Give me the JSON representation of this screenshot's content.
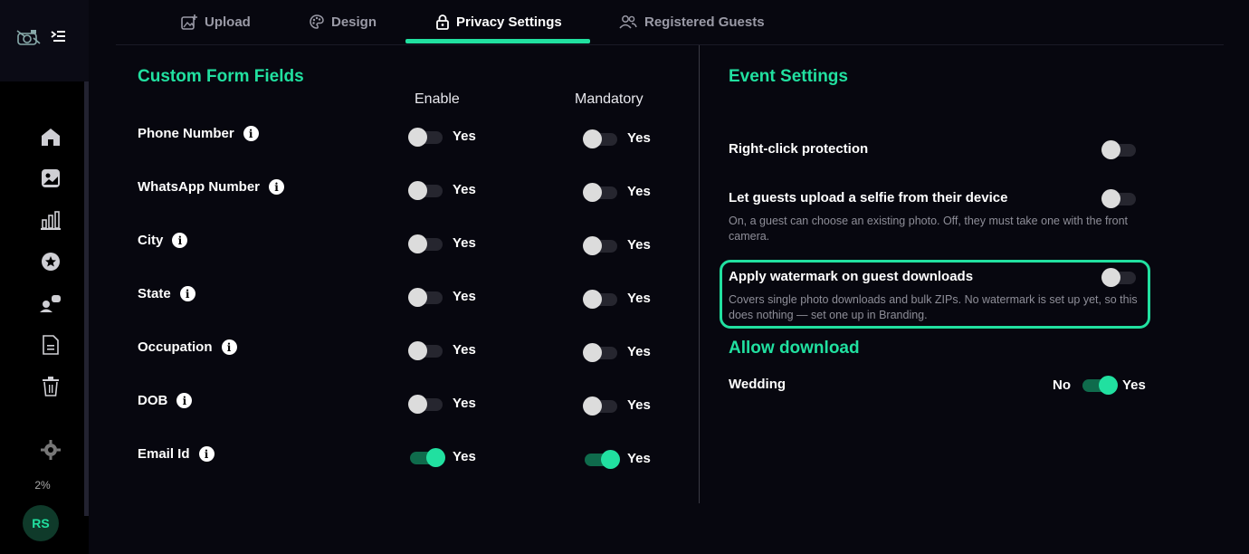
{
  "sidebar": {
    "usage_percent": "2%",
    "avatar_initials": "RS"
  },
  "tabs": [
    {
      "label": "Upload",
      "icon": "upload-image-icon"
    },
    {
      "label": "Design",
      "icon": "palette-icon"
    },
    {
      "label": "Privacy Settings",
      "icon": "lock-icon",
      "active": true
    },
    {
      "label": "Registered Guests",
      "icon": "guests-icon"
    }
  ],
  "custom_fields": {
    "title": "Custom Form Fields",
    "enable_header": "Enable",
    "mandatory_header": "Mandatory",
    "rows": [
      {
        "label": "Phone Number",
        "enable": false,
        "mandatory": false,
        "enable_text": "Yes",
        "mandatory_text": "Yes"
      },
      {
        "label": "WhatsApp Number",
        "enable": false,
        "mandatory": false,
        "enable_text": "Yes",
        "mandatory_text": "Yes"
      },
      {
        "label": "City",
        "enable": false,
        "mandatory": false,
        "enable_text": "Yes",
        "mandatory_text": "Yes"
      },
      {
        "label": "State",
        "enable": false,
        "mandatory": false,
        "enable_text": "Yes",
        "mandatory_text": "Yes"
      },
      {
        "label": "Occupation",
        "enable": false,
        "mandatory": false,
        "enable_text": "Yes",
        "mandatory_text": "Yes"
      },
      {
        "label": "DOB",
        "enable": false,
        "mandatory": false,
        "enable_text": "Yes",
        "mandatory_text": "Yes"
      },
      {
        "label": "Email Id",
        "enable": true,
        "mandatory": true,
        "enable_text": "Yes",
        "mandatory_text": "Yes"
      }
    ]
  },
  "event_settings": {
    "title": "Event Settings",
    "right_click": {
      "label": "Right-click protection",
      "on": false
    },
    "selfie_upload": {
      "label": "Let guests upload a selfie from their device",
      "description": "On, a guest can choose an existing photo. Off, they must take one with the front camera.",
      "on": false
    },
    "watermark": {
      "label": "Apply watermark on guest downloads",
      "description": "Covers single photo downloads and bulk ZIPs. No watermark is set up yet, so this does nothing — set one up in Branding.",
      "on": false
    }
  },
  "allow_download": {
    "title": "Allow download",
    "rows": [
      {
        "label": "Wedding",
        "no_text": "No",
        "yes_text": "Yes",
        "on": true
      }
    ]
  },
  "colors": {
    "accent": "#21e0a0",
    "background": "#07070f"
  }
}
